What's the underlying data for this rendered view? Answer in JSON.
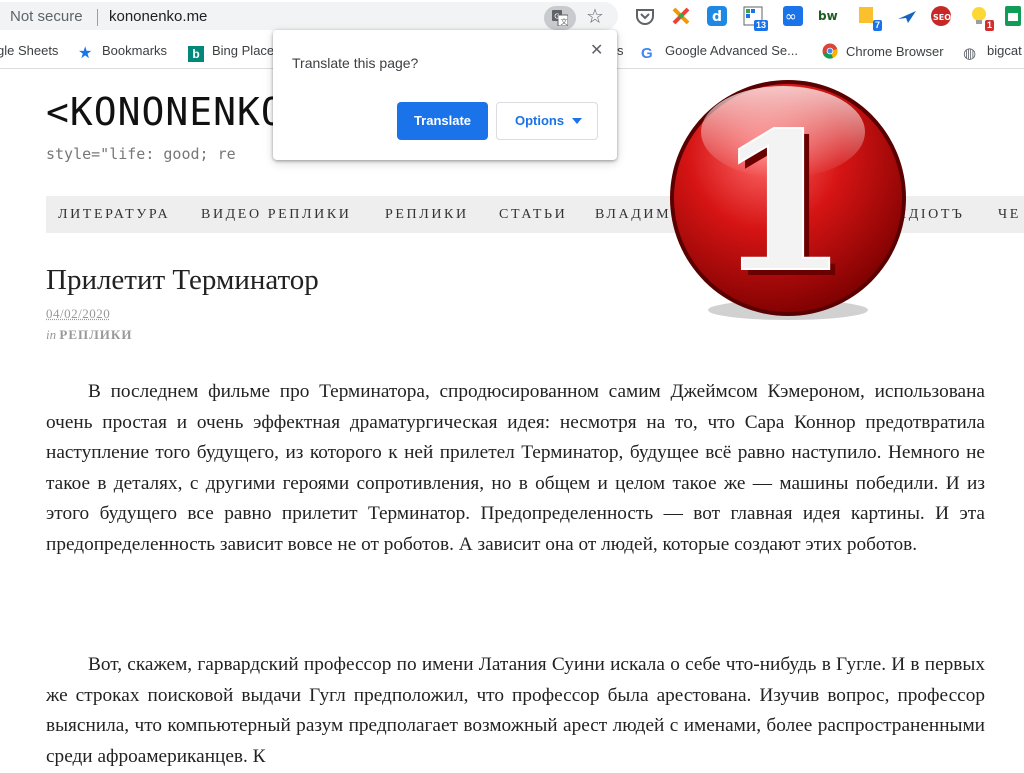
{
  "browser": {
    "security_label": "Not secure",
    "url": "kononenko.me",
    "extensions": [
      {
        "name": "pocket-icon",
        "badge": ""
      },
      {
        "name": "x-extension-icon",
        "badge": ""
      },
      {
        "name": "dictionary-icon",
        "badge": ""
      },
      {
        "name": "calendar-extension-icon",
        "badge": "13"
      },
      {
        "name": "infinity-icon",
        "badge": ""
      },
      {
        "name": "bw-icon",
        "badge": ""
      },
      {
        "name": "notes-icon",
        "badge": "7"
      },
      {
        "name": "airplane-icon",
        "badge": ""
      },
      {
        "name": "seo-icon",
        "badge": ""
      },
      {
        "name": "lightbulb-icon",
        "badge": "1"
      },
      {
        "name": "sheets-extension-icon",
        "badge": ""
      }
    ],
    "bookmarks": [
      {
        "label": "gle Sheets"
      },
      {
        "label": "Bookmarks"
      },
      {
        "label": "Bing Place"
      },
      {
        "label": "s"
      },
      {
        "label": "Google Advanced Se..."
      },
      {
        "label": "Chrome Browser"
      },
      {
        "label": "bigcat"
      }
    ]
  },
  "translate_popup": {
    "title": "Translate this page?",
    "translate_label": "Translate",
    "options_label": "Options"
  },
  "site": {
    "logo": "<KONONENKO",
    "tagline": "style=\"life: good; re"
  },
  "nav": {
    "items": [
      "ЛИТЕРАТУРА",
      "ВИДЕО РЕПЛИКИ",
      "РЕПЛИКИ",
      "СТАТЬИ",
      "ВЛАДИМ",
      "ИДІОТЪ",
      "ЧЕ"
    ]
  },
  "post": {
    "title": "Прилетит Терминатор",
    "date": "04/02/2020",
    "category_prefix": "in",
    "category": "РЕПЛИКИ",
    "paragraphs": [
      "В последнем фильме про Терминатора, спродюсированном самим Джеймсом Кэмероном, использована очень простая и очень эффектная драматургическая идея: несмотря на то, что Сара Коннор предотвратила наступление того будущего, из которого к ней прилетел Терминатор, будущее всё равно наступило. Немного не такое в деталях, с другими героями сопротивления, но в общем и целом такое же — машины победили. И из этого будущего все равно прилетит Терминатор. Предопределенность — вот главная идея картины. И эта предопределенность зависит вовсе не от роботов. А зависит она от людей, которые создают этих роботов.",
      "Вот, скажем, гарвардский профессор по имени Латания Суини искала о себе что-нибудь в Гугле. И в первых же строках поисковой выдачи Гугл предположил, что профессор была арестована. Изучив вопрос, профессор выяснила, что компьютерный разум предполагает возможный арест людей с именами, более распространенными среди афроамериканцев. К"
    ]
  },
  "overlay": {
    "number": "1"
  }
}
